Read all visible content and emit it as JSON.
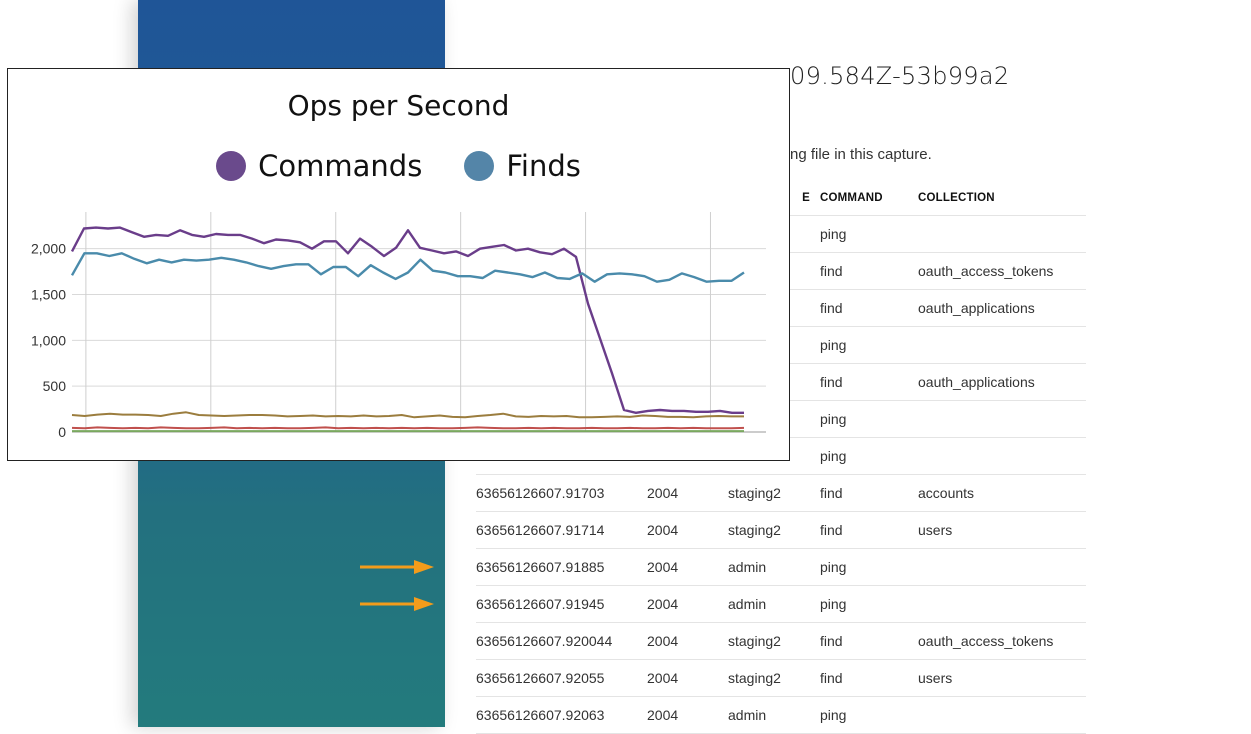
{
  "document": {
    "title_fragment": "09.584Z-53b99a2",
    "subtitle_fragment": "ng file in this capture."
  },
  "table": {
    "headers": {
      "type_fragment": "E",
      "command": "COMMAND",
      "collection": "COLLECTION"
    },
    "rows": [
      {
        "time": "",
        "op": "",
        "db": "",
        "command": "ping",
        "collection": ""
      },
      {
        "time": "",
        "op": "",
        "db": "",
        "command": "find",
        "collection": "oauth_access_tokens"
      },
      {
        "time": "",
        "op": "",
        "db": "",
        "command": "find",
        "collection": "oauth_applications"
      },
      {
        "time": "",
        "op": "",
        "db": "",
        "command": "ping",
        "collection": ""
      },
      {
        "time": "",
        "op": "",
        "db": "",
        "command": "find",
        "collection": "oauth_applications"
      },
      {
        "time": "",
        "op": "",
        "db": "",
        "command": "ping",
        "collection": ""
      },
      {
        "time": "",
        "op": "",
        "db": "",
        "command": "ping",
        "collection": ""
      },
      {
        "time": "63656126607.91703",
        "op": "2004",
        "db": "staging2",
        "command": "find",
        "collection": "accounts"
      },
      {
        "time": "63656126607.91714",
        "op": "2004",
        "db": "staging2",
        "command": "find",
        "collection": "users"
      },
      {
        "time": "63656126607.91885",
        "op": "2004",
        "db": "admin",
        "command": "ping",
        "collection": ""
      },
      {
        "time": "63656126607.91945",
        "op": "2004",
        "db": "admin",
        "command": "ping",
        "collection": ""
      },
      {
        "time": "63656126607.920044",
        "op": "2004",
        "db": "staging2",
        "command": "find",
        "collection": "oauth_access_tokens"
      },
      {
        "time": "63656126607.92055",
        "op": "2004",
        "db": "staging2",
        "command": "find",
        "collection": "users"
      },
      {
        "time": "63656126607.92063",
        "op": "2004",
        "db": "admin",
        "command": "ping",
        "collection": ""
      }
    ]
  },
  "arrows": {
    "color": "#f39c1b",
    "rows": [
      9,
      10
    ]
  },
  "sidebar": {
    "color_top": "#1f5597",
    "color_bottom": "#237b7d"
  },
  "chart_data": {
    "type": "line",
    "title": "Ops per Second",
    "legend": [
      {
        "name": "Commands",
        "color": "#6a4a8c"
      },
      {
        "name": "Finds",
        "color": "#5485a8"
      }
    ],
    "ylim": [
      0,
      2400
    ],
    "yticks": [
      0,
      500,
      1000,
      1500,
      2000
    ],
    "ytick_labels": [
      "0",
      "500",
      "1,000",
      "1,500",
      "2,000"
    ],
    "grid": true,
    "x_count": 60,
    "series": [
      {
        "color": "#6a3d8a",
        "values": [
          1970,
          2220,
          2230,
          2220,
          2230,
          2180,
          2130,
          2150,
          2140,
          2200,
          2150,
          2130,
          2160,
          2150,
          2150,
          2110,
          2060,
          2100,
          2090,
          2070,
          2000,
          2080,
          2080,
          1950,
          2110,
          2020,
          1920,
          2010,
          2200,
          2010,
          1980,
          1950,
          1970,
          1920,
          2000,
          2020,
          2040,
          1980,
          2000,
          1960,
          1940,
          2000,
          1910,
          1400,
          1020,
          640,
          240,
          210,
          230,
          240,
          230,
          230,
          220,
          220,
          230,
          210,
          210
        ]
      },
      {
        "color": "#4a8bab",
        "values": [
          1710,
          1950,
          1950,
          1920,
          1950,
          1890,
          1840,
          1880,
          1850,
          1880,
          1870,
          1880,
          1900,
          1880,
          1850,
          1810,
          1780,
          1810,
          1830,
          1830,
          1720,
          1800,
          1800,
          1700,
          1820,
          1740,
          1670,
          1740,
          1880,
          1760,
          1740,
          1700,
          1700,
          1680,
          1760,
          1740,
          1720,
          1690,
          1740,
          1680,
          1670,
          1730,
          1640,
          1720,
          1730,
          1720,
          1700,
          1640,
          1660,
          1730,
          1690,
          1640,
          1650,
          1650,
          1740
        ]
      },
      {
        "color": "#9b7d3e",
        "values": [
          185,
          175,
          190,
          200,
          190,
          190,
          185,
          175,
          200,
          215,
          185,
          180,
          175,
          180,
          185,
          185,
          180,
          170,
          175,
          180,
          170,
          175,
          170,
          180,
          170,
          175,
          185,
          160,
          170,
          180,
          165,
          160,
          175,
          185,
          200,
          170,
          165,
          175,
          170,
          175,
          160,
          160,
          165,
          170,
          165,
          180,
          175,
          165,
          165,
          160,
          170,
          175,
          170,
          170
        ]
      },
      {
        "color": "#c0504d",
        "values": [
          45,
          40,
          50,
          45,
          40,
          45,
          40,
          50,
          45,
          40,
          40,
          45,
          50,
          40,
          45,
          40,
          45,
          40,
          40,
          45,
          50,
          40,
          45,
          40,
          45,
          40,
          45,
          40,
          45,
          40,
          40,
          45,
          50,
          45,
          40,
          40,
          45,
          40,
          45,
          40,
          40,
          45,
          40,
          40,
          45,
          40,
          40,
          45,
          40,
          45,
          40,
          40,
          40,
          45
        ]
      },
      {
        "color": "#7aa85f",
        "values": [
          10,
          10,
          10,
          10,
          10,
          10,
          10,
          10,
          10,
          10,
          10,
          10,
          10,
          10,
          10,
          10,
          10,
          10,
          10,
          10,
          10,
          10,
          10,
          10,
          10,
          10,
          10,
          10,
          10,
          10,
          10,
          10,
          10,
          10,
          10,
          10,
          10,
          10,
          10,
          10,
          10,
          10,
          10,
          10,
          10,
          10,
          10,
          10,
          10,
          10,
          10,
          10,
          10,
          10
        ]
      }
    ]
  }
}
